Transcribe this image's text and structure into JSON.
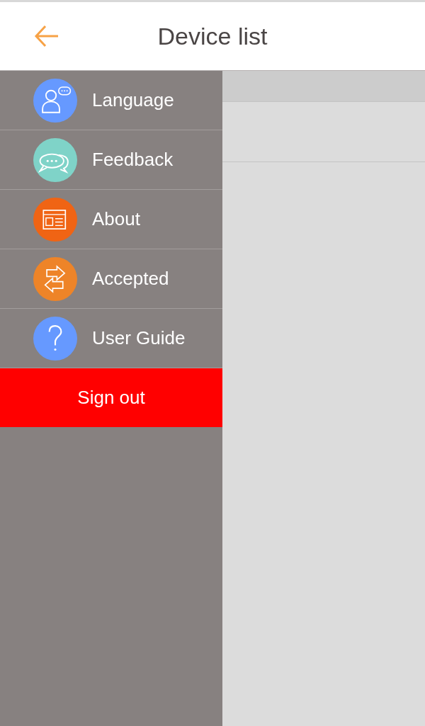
{
  "header": {
    "title": "Device list"
  },
  "drawer": {
    "items": [
      {
        "label": "Language",
        "kind": "language",
        "color": "#6699ff"
      },
      {
        "label": "Feedback",
        "kind": "feedback",
        "color": "#7fd3c8"
      },
      {
        "label": "About",
        "kind": "about",
        "color": "#f06414"
      },
      {
        "label": "Accepted",
        "kind": "accepted",
        "color": "#ee8428"
      },
      {
        "label": "User Guide",
        "kind": "guide",
        "color": "#6699ff"
      }
    ],
    "sign_out": "Sign out"
  }
}
